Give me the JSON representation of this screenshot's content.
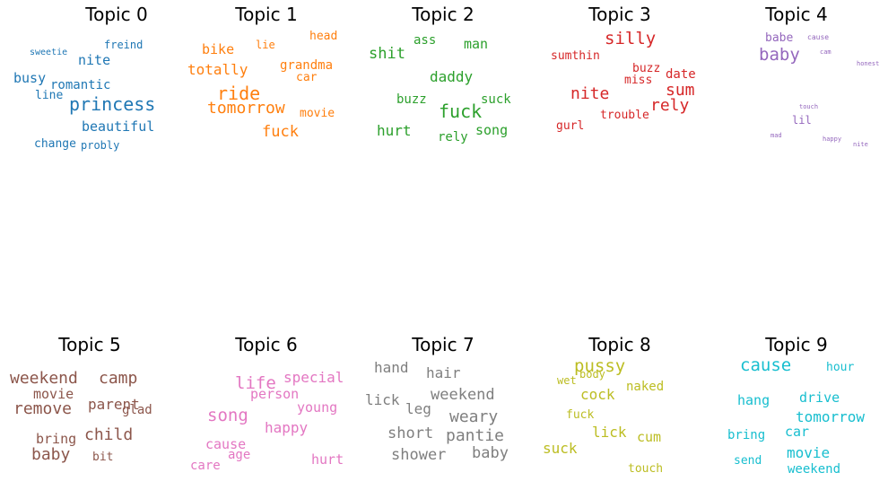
{
  "chart_data": {
    "type": "wordcloud",
    "panels": [
      {
        "title": "Topic 0",
        "color": "#1f77b4",
        "words": [
          {
            "text": "princess",
            "weight": 1.0
          },
          {
            "text": "nite",
            "weight": 0.62
          },
          {
            "text": "busy",
            "weight": 0.6
          },
          {
            "text": "beautiful",
            "weight": 0.6
          },
          {
            "text": "romantic",
            "weight": 0.55
          },
          {
            "text": "line",
            "weight": 0.5
          },
          {
            "text": "change",
            "weight": 0.5
          },
          {
            "text": "freind",
            "weight": 0.48
          },
          {
            "text": "probly",
            "weight": 0.45
          },
          {
            "text": "sweetie",
            "weight": 0.4
          }
        ]
      },
      {
        "title": "Topic 1",
        "color": "#ff7f0e",
        "words": [
          {
            "text": "ride",
            "weight": 1.0
          },
          {
            "text": "tomorrow",
            "weight": 0.92
          },
          {
            "text": "fuck",
            "weight": 0.88
          },
          {
            "text": "totally",
            "weight": 0.8
          },
          {
            "text": "bike",
            "weight": 0.78
          },
          {
            "text": "grandma",
            "weight": 0.68
          },
          {
            "text": "car",
            "weight": 0.6
          },
          {
            "text": "movie",
            "weight": 0.6
          },
          {
            "text": "head",
            "weight": 0.58
          },
          {
            "text": "lie",
            "weight": 0.55
          }
        ]
      },
      {
        "title": "Topic 2",
        "color": "#2ca02c",
        "words": [
          {
            "text": "fuck",
            "weight": 1.0
          },
          {
            "text": "shit",
            "weight": 0.9
          },
          {
            "text": "hurt",
            "weight": 0.85
          },
          {
            "text": "daddy",
            "weight": 0.8
          },
          {
            "text": "man",
            "weight": 0.75
          },
          {
            "text": "ass",
            "weight": 0.7
          },
          {
            "text": "buzz",
            "weight": 0.7
          },
          {
            "text": "suck",
            "weight": 0.7
          },
          {
            "text": "song",
            "weight": 0.7
          },
          {
            "text": "rely",
            "weight": 0.68
          }
        ]
      },
      {
        "title": "Topic 3",
        "color": "#d62728",
        "words": [
          {
            "text": "silly",
            "weight": 1.0
          },
          {
            "text": "sum",
            "weight": 0.98
          },
          {
            "text": "rely",
            "weight": 0.98
          },
          {
            "text": "nite",
            "weight": 0.95
          },
          {
            "text": "date",
            "weight": 0.7
          },
          {
            "text": "buzz",
            "weight": 0.65
          },
          {
            "text": "miss",
            "weight": 0.65
          },
          {
            "text": "trouble",
            "weight": 0.65
          },
          {
            "text": "gurl",
            "weight": 0.65
          },
          {
            "text": "sumthin",
            "weight": 0.6
          }
        ]
      },
      {
        "title": "Topic 4",
        "color": "#9467bd",
        "words": [
          {
            "text": "baby",
            "weight": 1.0
          },
          {
            "text": "babe",
            "weight": 0.6
          },
          {
            "text": "lil",
            "weight": 0.55
          },
          {
            "text": "cause",
            "weight": 0.35
          },
          {
            "text": "cam",
            "weight": 0.3
          },
          {
            "text": "honest",
            "weight": 0.3
          },
          {
            "text": "touch",
            "weight": 0.28
          },
          {
            "text": "mad",
            "weight": 0.28
          },
          {
            "text": "happy",
            "weight": 0.28
          },
          {
            "text": "nite",
            "weight": 0.28
          }
        ]
      },
      {
        "title": "Topic 5",
        "color": "#8c564b",
        "words": [
          {
            "text": "weekend",
            "weight": 1.0
          },
          {
            "text": "camp",
            "weight": 1.0
          },
          {
            "text": "remove",
            "weight": 1.0
          },
          {
            "text": "child",
            "weight": 1.0
          },
          {
            "text": "baby",
            "weight": 1.0
          },
          {
            "text": "parent",
            "weight": 0.85
          },
          {
            "text": "glad",
            "weight": 0.75
          },
          {
            "text": "movie",
            "weight": 0.8
          },
          {
            "text": "bring",
            "weight": 0.8
          },
          {
            "text": "bit",
            "weight": 0.7
          }
        ]
      },
      {
        "title": "Topic 6",
        "color": "#e377c2",
        "words": [
          {
            "text": "life",
            "weight": 1.0
          },
          {
            "text": "song",
            "weight": 1.0
          },
          {
            "text": "special",
            "weight": 0.8
          },
          {
            "text": "person",
            "weight": 0.75
          },
          {
            "text": "young",
            "weight": 0.75
          },
          {
            "text": "happy",
            "weight": 0.8
          },
          {
            "text": "cause",
            "weight": 0.75
          },
          {
            "text": "age",
            "weight": 0.7
          },
          {
            "text": "care",
            "weight": 0.7
          },
          {
            "text": "hurt",
            "weight": 0.75
          }
        ]
      },
      {
        "title": "Topic 7",
        "color": "#7f7f7f",
        "words": [
          {
            "text": "weary",
            "weight": 1.0
          },
          {
            "text": "pantie",
            "weight": 1.0
          },
          {
            "text": "weekend",
            "weight": 0.95
          },
          {
            "text": "short",
            "weight": 0.95
          },
          {
            "text": "shower",
            "weight": 0.92
          },
          {
            "text": "baby",
            "weight": 0.92
          },
          {
            "text": "hair",
            "weight": 0.85
          },
          {
            "text": "hand",
            "weight": 0.85
          },
          {
            "text": "lick",
            "weight": 0.85
          },
          {
            "text": "leg",
            "weight": 0.85
          }
        ]
      },
      {
        "title": "Topic 8",
        "color": "#bcbd22",
        "words": [
          {
            "text": "pussy",
            "weight": 1.0
          },
          {
            "text": "cock",
            "weight": 0.8
          },
          {
            "text": "lick",
            "weight": 0.8
          },
          {
            "text": "suck",
            "weight": 0.8
          },
          {
            "text": "cum",
            "weight": 0.75
          },
          {
            "text": "naked",
            "weight": 0.7
          },
          {
            "text": "fuck",
            "weight": 0.65
          },
          {
            "text": "touch",
            "weight": 0.65
          },
          {
            "text": "wet",
            "weight": 0.6
          },
          {
            "text": "body",
            "weight": 0.6
          }
        ]
      },
      {
        "title": "Topic 9",
        "color": "#17becf",
        "words": [
          {
            "text": "cause",
            "weight": 1.0
          },
          {
            "text": "tomorrow",
            "weight": 0.9
          },
          {
            "text": "movie",
            "weight": 0.9
          },
          {
            "text": "drive",
            "weight": 0.8
          },
          {
            "text": "hang",
            "weight": 0.8
          },
          {
            "text": "car",
            "weight": 0.8
          },
          {
            "text": "bring",
            "weight": 0.75
          },
          {
            "text": "weekend",
            "weight": 0.75
          },
          {
            "text": "hour",
            "weight": 0.7
          },
          {
            "text": "send",
            "weight": 0.7
          }
        ]
      }
    ]
  }
}
